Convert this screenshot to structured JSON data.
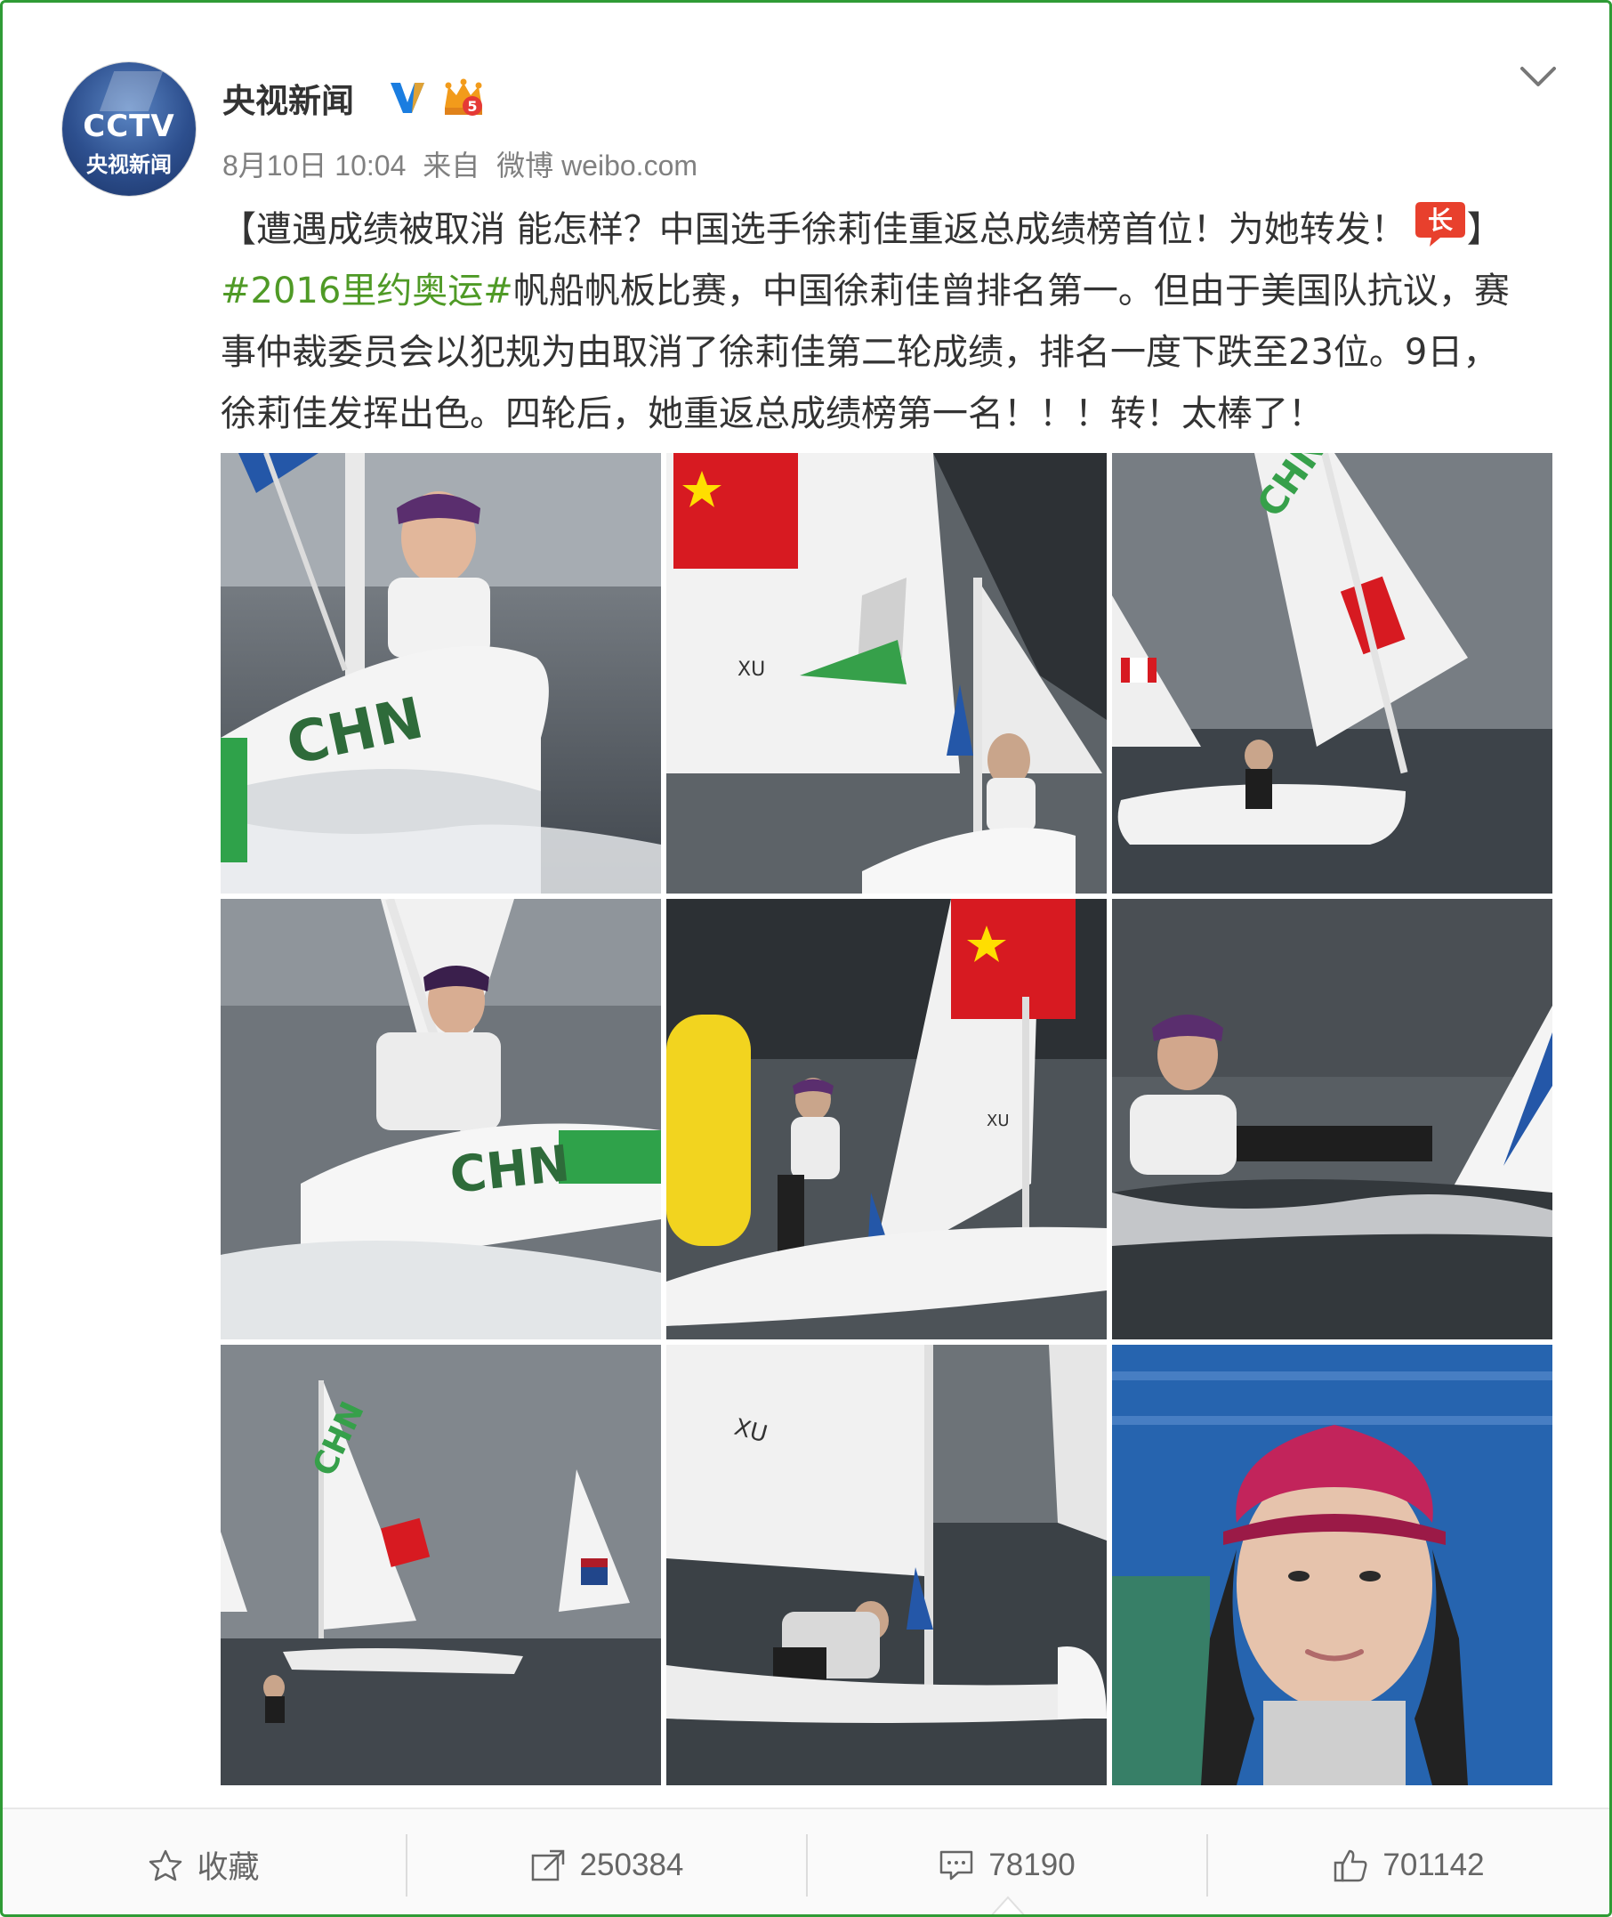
{
  "account": {
    "avatar_text_top": "CCTV",
    "avatar_text_sub": "央视新闻",
    "name": "央视新闻",
    "verified_icon": "verified-v-icon",
    "vip_level": "5"
  },
  "meta": {
    "date": "8月10日 10:04",
    "from_label": "来自",
    "source": "微博 weibo.com"
  },
  "post": {
    "title_part": "【遭遇成绩被取消 能怎样？中国选手徐莉佳重返总成绩榜首位！为她转发！",
    "title_close": "】",
    "hashtag": "#2016里约奥运#",
    "body": "帆船帆板比赛，中国徐莉佳曾排名第一。但由于美国队抗议，赛事仲裁委员会以犯规为由取消了徐莉佳第二轮成绩，排名一度下跌至23位。9日，徐莉佳发挥出色。四轮后，她重返总成绩榜第一名！！！转！太棒了！",
    "badge_icon": "long-weibo-icon",
    "badge_text": "长"
  },
  "photos": [
    {
      "caption": "CHN"
    },
    {
      "caption": "XU"
    },
    {
      "caption": "CHN"
    },
    {
      "caption": "CHN"
    },
    {
      "caption": "XU"
    },
    {
      "caption": ""
    },
    {
      "caption": "CHN"
    },
    {
      "caption": "XU"
    },
    {
      "caption": ""
    }
  ],
  "actions": {
    "favorite": "收藏",
    "repost": "250384",
    "comment": "78190",
    "like": "701142"
  },
  "colors": {
    "frame": "#2f9b35",
    "hashtag": "#4f9a26",
    "text": "#333333",
    "meta": "#808080"
  }
}
